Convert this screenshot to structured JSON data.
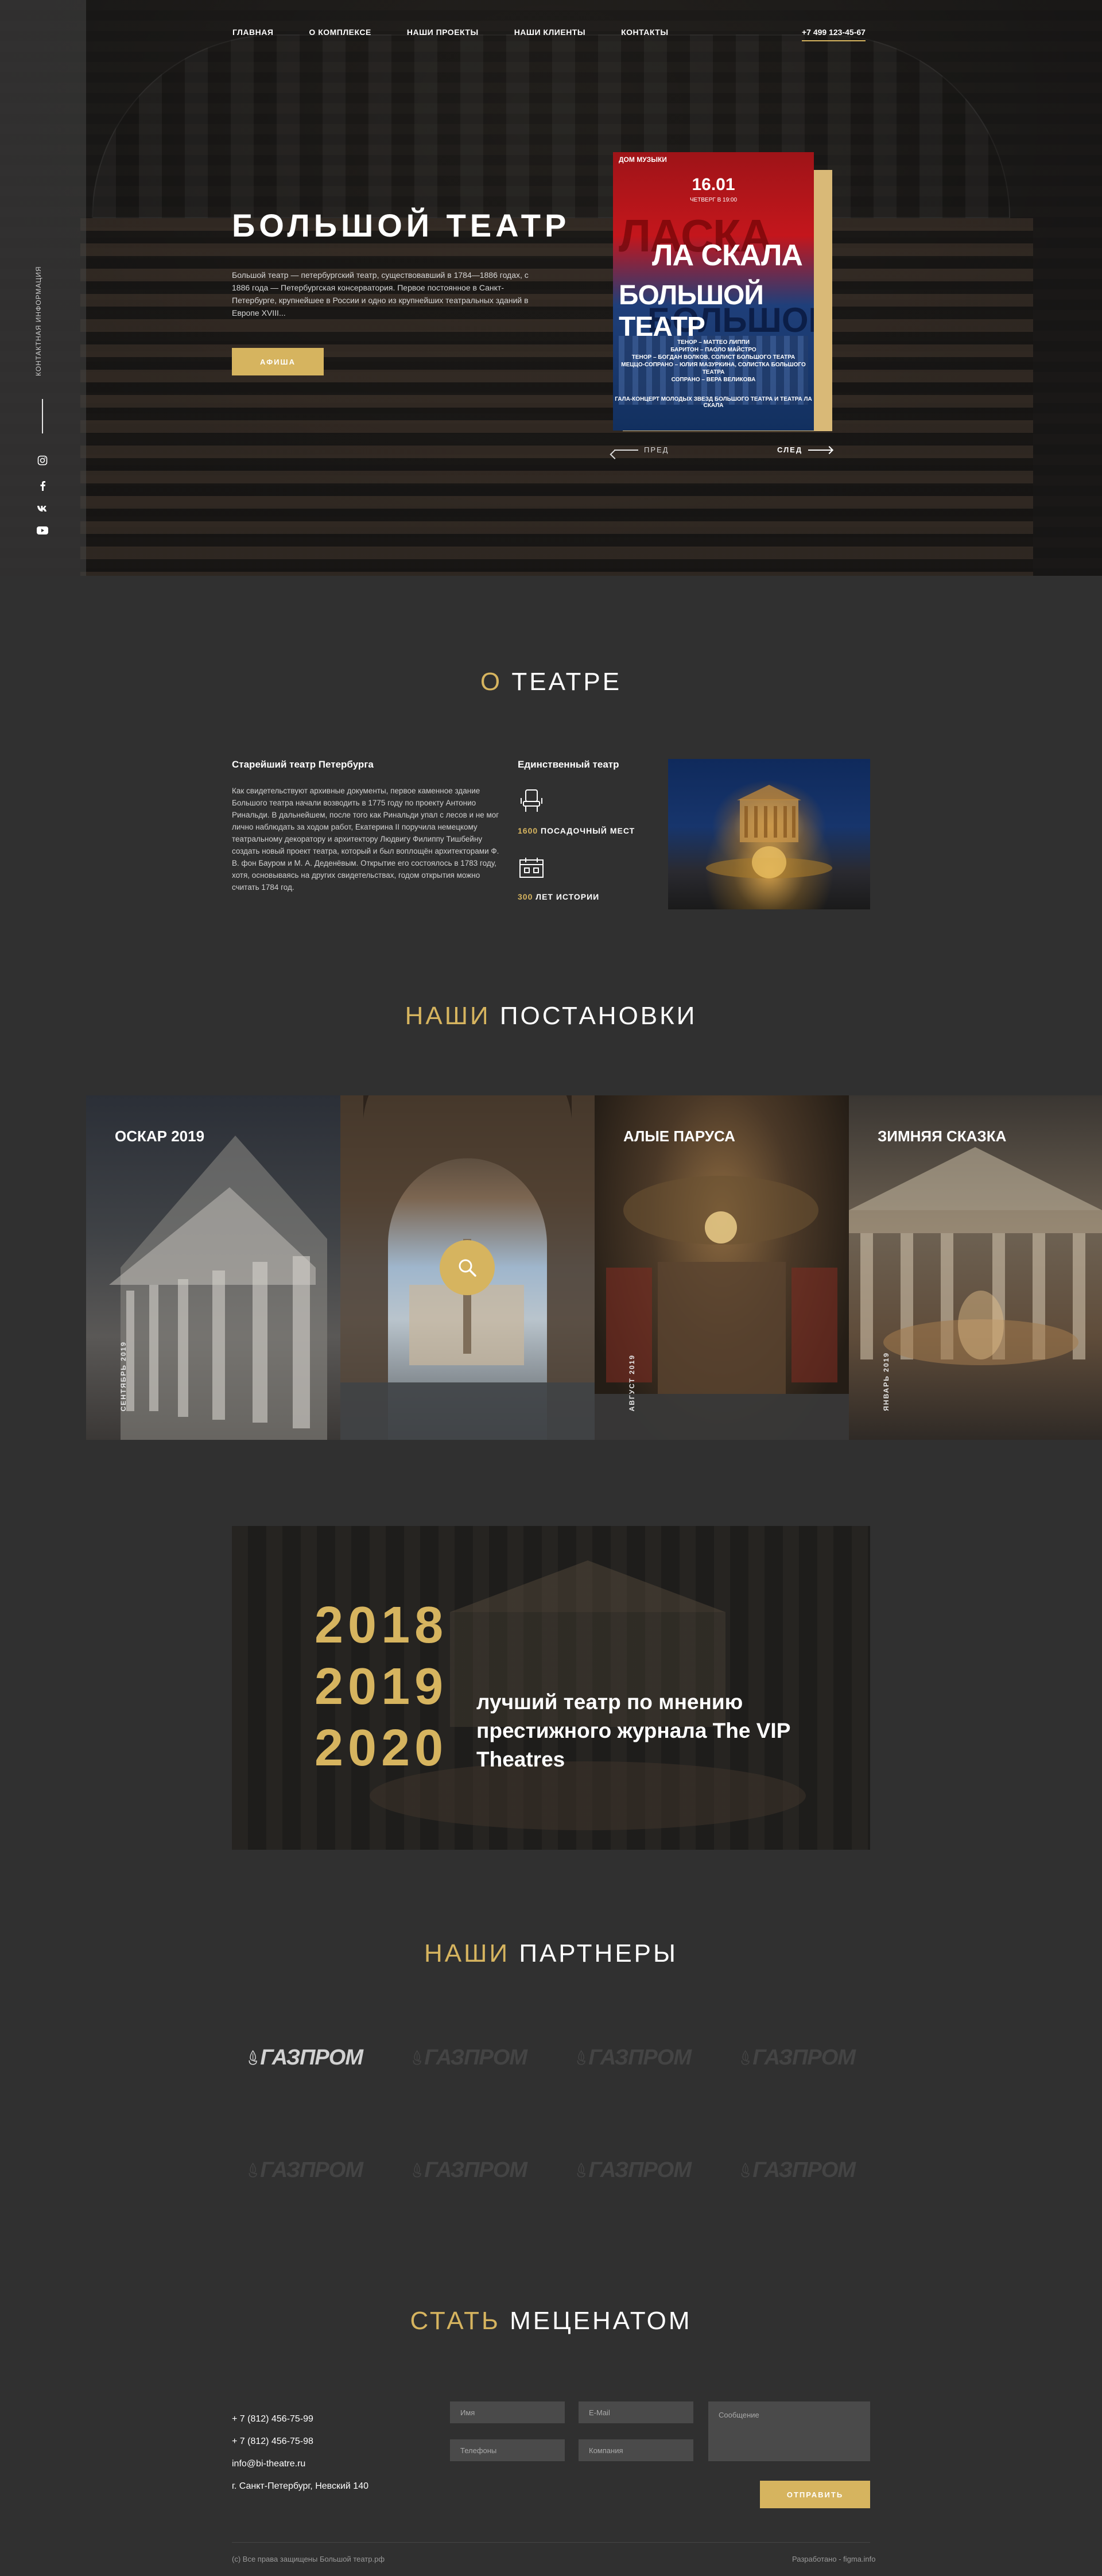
{
  "header": {
    "nav": [
      "ГЛАВНАЯ",
      "О КОМПЛЕКСЕ",
      "НАШИ ПРОЕКТЫ",
      "НАШИ КЛИЕНТЫ",
      "КОНТАКТЫ"
    ],
    "phone": "+7 499 123-45-67"
  },
  "sidebar": {
    "label": "КОНТАКТНАЯ ИНФОРМАЦИЯ",
    "socials": [
      "instagram-icon",
      "facebook-icon",
      "vk-icon",
      "youtube-icon"
    ]
  },
  "hero": {
    "title": "БОЛЬШОЙ ТЕАТР",
    "description": "Большой театр — петербургский театр, существовавший в 1784—1886 годах, с 1886 года — Петербургская консерватория. Первое постоянное в Санкт-Петербурге, крупнейшее в России и одно из крупнейших театральных зданий в Европе XVIII...",
    "button": "АФИША",
    "poster": {
      "brand": "ДОМ МУЗЫКИ",
      "date": "16.01",
      "sub": "ЧЕТВЕРГ В 19:00",
      "title_1": "ЛА СКАЛА",
      "title_2": "БОЛЬШОЙ ТЕАТР",
      "info": "ТЕНОР – МАТТЕО ЛИППИ\nБАРИТОН – ПАОЛО МАЙСТРО\nТЕНОР – БОГДАН ВОЛКОВ, СОЛИСТ БОЛЬШОГО ТЕАТРА\nМЕЦЦО-СОПРАНО – ЮЛИЯ МАЗУРКИНА, СОЛИСТКА БОЛЬШОГО ТЕАТРА\nСОПРАНО – ВЕРА ВЕЛИКОВА",
      "footer": "ГАЛА-КОНЦЕРТ МОЛОДЫХ ЗВЕЗД БОЛЬШОГО ТЕАТРА И ТЕАТРА ЛА СКАЛА"
    },
    "prev": "ПРЕД",
    "next": "СЛЕД"
  },
  "about": {
    "title_accent": "О",
    "title_rest": " ТЕАТРЕ",
    "left_title": "Старейший театр Петербурга",
    "left_text": "Как свидетельствуют архивные документы, первое каменное здание Большого театра начали возводить в 1775 году по проекту Антонио Ринальди. В дальнейшем, после того как Ринальди упал с лесов и не мог лично наблюдать за ходом работ, Екатерина II поручила немецкому театральному декоратору и архитектору Людвигу Филиппу Тишбейну создать новый проект театра, который и был воплощён архитекторами Ф. В. фон Бауром и М. А. Деденёвым. Открытие его состоялось в 1783 году, хотя, основываясь на других свидетельствах, годом открытия можно считать 1784 год.",
    "mid_title": "Единственный театр",
    "stats": [
      {
        "icon": "seat-icon",
        "value": "1600",
        "label": " ПОСАДОЧНЫЙ МЕСТ"
      },
      {
        "icon": "history-icon",
        "value": "300",
        "label": " ЛЕТ ИСТОРИИ"
      }
    ]
  },
  "productions": {
    "title_accent": "НАШИ",
    "title_rest": " ПОСТАНОВКИ",
    "items": [
      {
        "title": "ОСКАР 2019",
        "date": "СЕНТЯБРЬ 2019"
      },
      {
        "title": "",
        "date": ""
      },
      {
        "title": "АЛЫЕ ПАРУСА",
        "date": "АВГУСТ 2019"
      },
      {
        "title": "ЗИМНЯЯ СКАЗКА",
        "date": "ЯНВАРЬ 2019"
      }
    ]
  },
  "award": {
    "years": [
      "2018",
      "2019",
      "2020"
    ],
    "text": "лучший театр по мнению престижного журнала The VIP Theatres"
  },
  "partners": {
    "title_accent": "НАШИ",
    "title_rest": " ПАРТНЕРЫ",
    "items": [
      "ГАЗПРОМ",
      "ГАЗПРОМ",
      "ГАЗПРОМ",
      "ГАЗПРОМ",
      "ГАЗПРОМ",
      "ГАЗПРОМ",
      "ГАЗПРОМ",
      "ГАЗПРОМ"
    ]
  },
  "patron": {
    "title_accent": "СТАТЬ",
    "title_rest": " МЕЦЕНАТОМ",
    "phone_1": "+ 7 (812) 456-75-99",
    "phone_2": "+ 7 (812) 456-75-98",
    "email": "info@bi-theatre.ru",
    "address": "г. Санкт-Петербург, Невский 140",
    "form": {
      "name": "Имя",
      "email": "E-Mail",
      "message": "Сообщение",
      "phone": "Телефоны",
      "company": "Компания",
      "submit": "ОТПРАВИТЬ"
    }
  },
  "footer": {
    "copyright": "(c) Все права защищены Большой театр.рф",
    "developer": "Разработано - figma.info"
  },
  "colors": {
    "accent": "#d6b45f",
    "background": "#303030"
  }
}
